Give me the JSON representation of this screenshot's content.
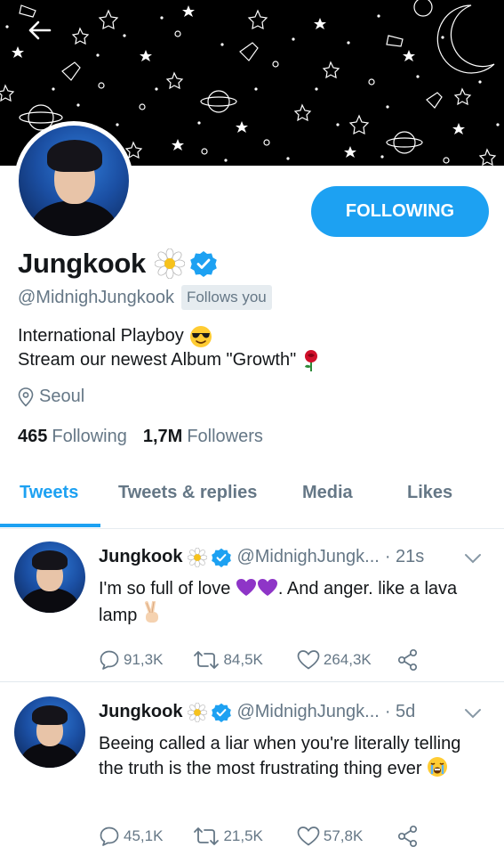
{
  "profile": {
    "display_name": "Jungkook",
    "handle": "@MidnighJungkook",
    "follows_you_label": "Follows you",
    "bio_line1": "International Playboy",
    "bio_line2": "Stream our newest Album \"Growth\"",
    "location": "Seoul",
    "following_count": "465",
    "following_label": "Following",
    "followers_count": "1,7M",
    "followers_label": "Followers",
    "follow_button_label": "FOLLOWING"
  },
  "tabs": [
    {
      "label": "Tweets",
      "active": true
    },
    {
      "label": "Tweets & replies",
      "active": false
    },
    {
      "label": "Media",
      "active": false
    },
    {
      "label": "Likes",
      "active": false
    }
  ],
  "tweets": [
    {
      "name": "Jungkook",
      "handle": "@MidnighJungk...",
      "time": "· 21s",
      "text_a": "I'm so full of love ",
      "text_b": ". And anger. like a lava lamp ",
      "replies": "91,3K",
      "retweets": "84,5K",
      "likes": "264,3K"
    },
    {
      "name": "Jungkook",
      "handle": "@MidnighJungk...",
      "time": "· 5d",
      "text_a": "Beeing called a liar when you're literally telling the truth is the most frustrating thing ever ",
      "replies": "45,1K",
      "retweets": "21,5K",
      "likes": "57,8K"
    }
  ],
  "colors": {
    "accent": "#1da1f2",
    "secondary_text": "#657786",
    "header_bg": "#000000"
  },
  "icons": [
    "back-arrow-icon",
    "flower-icon",
    "verified-badge-icon",
    "location-pin-icon",
    "sunglasses-emoji-icon",
    "rose-emoji-icon",
    "purple-heart-icon",
    "peace-hand-icon",
    "crying-face-icon",
    "reply-icon",
    "retweet-icon",
    "like-icon",
    "share-icon",
    "chevron-down-icon"
  ]
}
